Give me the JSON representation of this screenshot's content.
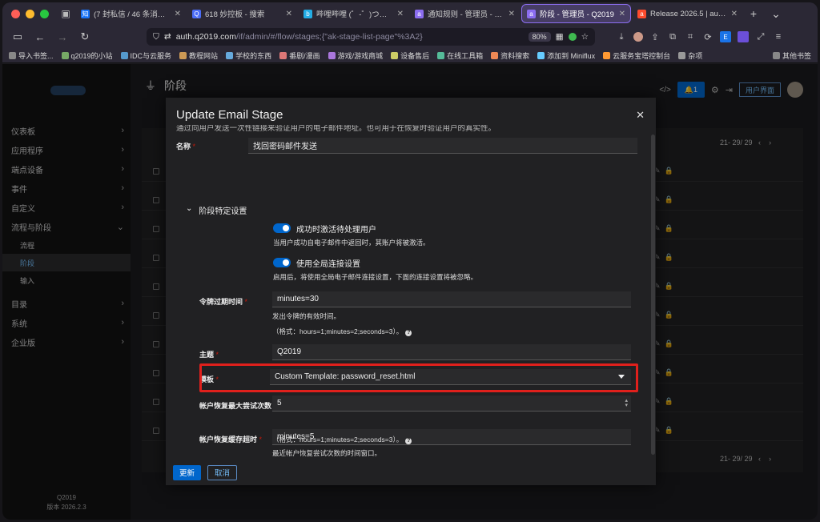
{
  "browser": {
    "tabs": [
      {
        "label": "(7 封私信 / 46 条消息) 妙控板",
        "fav_color": "#1772f6",
        "fav_glyph": "知"
      },
      {
        "label": "618 妙控板 - 搜索",
        "fav_color": "#4a6cf7",
        "fav_glyph": "Q"
      },
      {
        "label": "哔哩哔哩 (゜-゜)つロ 干杯~",
        "fav_color": "#23ade5",
        "fav_glyph": "b"
      },
      {
        "label": "通知规则 - 管理员 - Q2019",
        "fav_color": "#8b6df0",
        "fav_glyph": "a"
      },
      {
        "label": "阶段 - 管理员 - Q2019",
        "fav_color": "#8b6df0",
        "fav_glyph": "a"
      },
      {
        "label": "Release 2026.5 | authentik",
        "fav_color": "#fd4b2d",
        "fav_glyph": "a"
      }
    ],
    "url_host": "auth.q2019.com",
    "url_path": "/if/admin/#/flow/stages;{\"ak-stage-list-page\"%3A2}",
    "zoom": "80%",
    "bookmarks": [
      "导入书签...",
      "q2019的小站",
      "IDC与云服务",
      "教程网站",
      "学校的东西",
      "番剧/漫画",
      "游戏/游戏商城",
      "设备售后",
      "在线工具箱",
      "资料搜索",
      "添加到 Miniflux",
      "云服务宝塔控制台",
      "杂项"
    ],
    "bookmarks_right": "其他书签"
  },
  "sidebar": {
    "items": [
      {
        "label": "仪表板"
      },
      {
        "label": "应用程序"
      },
      {
        "label": "端点设备"
      },
      {
        "label": "事件"
      },
      {
        "label": "自定义"
      },
      {
        "label": "流程与阶段",
        "expanded": true
      }
    ],
    "subitems": [
      "流程",
      "阶段",
      "输入"
    ],
    "items_after": [
      {
        "label": "目录"
      },
      {
        "label": "系统"
      },
      {
        "label": "企业版"
      }
    ],
    "footer_name": "Q2019",
    "footer_version": "版本 2026.2.3"
  },
  "page": {
    "title": "阶段",
    "bell_count": "1",
    "user_button": "用户界面",
    "pager_top": "21- 29/ 29",
    "pager_bottom": "21- 29/ 29"
  },
  "modal": {
    "title": "Update Email Stage",
    "description": "通过向用户发送一次性链接来验证用户的电子邮件地址。也可用于在恢复时验证用户的真实性。",
    "name_label": "名称",
    "name_value": "找回密码邮件发送",
    "section_title": "阶段特定设置",
    "switch1_label": "成功时激活待处理用户",
    "switch1_help": "当用户成功自电子邮件中返回时，其账户将被激活。",
    "switch2_label": "使用全局连接设置",
    "switch2_help": "启用后，将使用全局电子邮件连接设置，下面的连接设置将被忽略。",
    "token_label": "令牌过期时间",
    "token_value": "minutes=30",
    "token_help1": "发出令牌的有效时间。",
    "token_help2": "（格式：hours=1;minutes=2;seconds=3）。",
    "subject_label": "主题",
    "subject_value": "Q2019",
    "template_label": "模板",
    "template_value": "Custom Template: password_reset.html",
    "recovery_label": "帐户恢复最大尝试次数",
    "recovery_value": "5",
    "cache_label": "帐户恢复缓存超时",
    "cache_value": "minutes=5",
    "cache_help1": "最近帐户恢复尝试次数的时间窗口。",
    "cache_help2": "（格式：hours=1;minutes=2;seconds=3）。",
    "update_button": "更新",
    "cancel_button": "取消"
  }
}
